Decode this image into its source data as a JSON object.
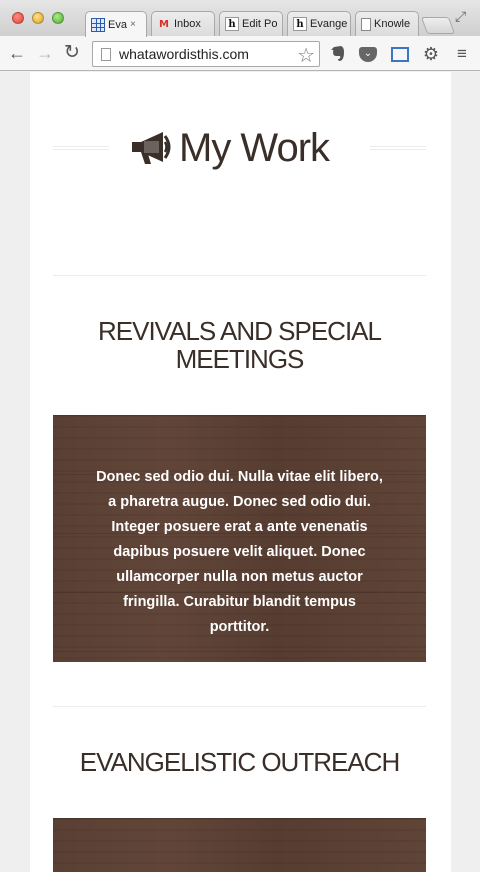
{
  "browser": {
    "tabs": [
      {
        "label": "Eva",
        "favicon": "grid-favicon",
        "active": true,
        "close": "×"
      },
      {
        "label": "Inbox",
        "favicon": "gmail-favicon",
        "active": false
      },
      {
        "label": "Edit Po",
        "favicon": "h-favicon",
        "active": false
      },
      {
        "label": "Evange",
        "favicon": "h-favicon",
        "active": false
      },
      {
        "label": "Knowle",
        "favicon": "page-favicon",
        "active": false
      }
    ],
    "url": "whatawordisthis.com",
    "icons": {
      "back": "←",
      "forward": "→",
      "reload": "↻",
      "star": "☆",
      "gear": "⚙",
      "menu": "≡",
      "fullscreen": "⤢"
    }
  },
  "page": {
    "hero_title": "My Work",
    "sections": [
      {
        "title": "REVIVALS AND SPECIAL MEETINGS",
        "body": "Donec sed odio dui. Nulla vitae elit libero, a pharetra augue. Donec sed odio dui. Integer posuere erat a ante venenatis dapibus posuere velit aliquet. Donec ullamcorper nulla non metus auctor fringilla. Curabitur blandit tempus porttitor."
      },
      {
        "title": "EVANGELISTIC OUTREACH",
        "body": ""
      }
    ]
  },
  "colors": {
    "heading": "#3a2e28",
    "wood": "#5a4034",
    "accent_link": "#3a76c4"
  }
}
